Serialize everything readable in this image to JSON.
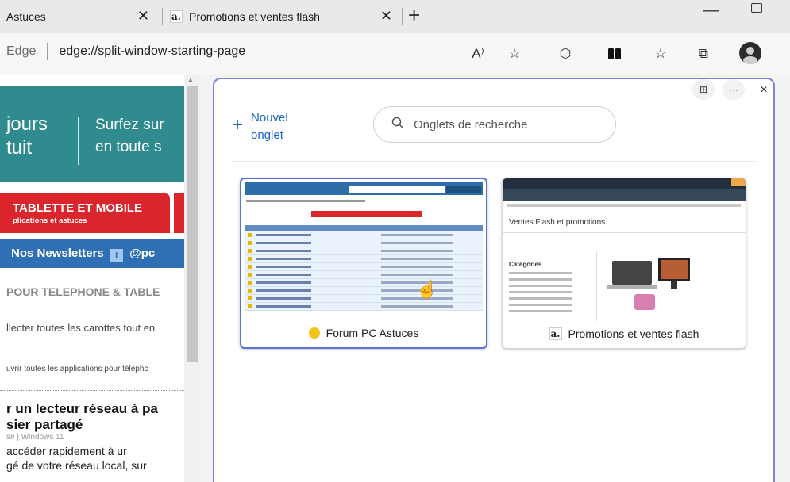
{
  "tabs": [
    {
      "label": "Astuces",
      "close": "✕"
    },
    {
      "label": "Promotions et ventes flash",
      "close": "✕",
      "favicon": "a."
    }
  ],
  "tab_new": "+",
  "window": {
    "minimize": "—"
  },
  "address": {
    "scheme": "Edge",
    "url": "edge://split-window-starting-page"
  },
  "toolbar_icons": [
    "read-aloud-icon",
    "add-favorite-icon",
    "copilot-icon",
    "split-screen-icon",
    "favorites-icon",
    "collections-icon",
    "profile-icon"
  ],
  "toolbar_glyphs": {
    "read_aloud": "A⁾",
    "add_favorite": "☆",
    "copilot": "⬡",
    "favorites": "☆",
    "collections": "⧉"
  },
  "left_page": {
    "banner_left": [
      "jours",
      "tuit"
    ],
    "banner_right": [
      "Surfez sur",
      "en toute s"
    ],
    "category": "TABLETTE ET MOBILE",
    "category_sub": "plications et astuces",
    "newsletters": "Nos Newsletters",
    "twitter_handle": "@pc",
    "section_heading": "POUR TELEPHONE & TABLE",
    "snippet_1": "llecter toutes les carottes tout en",
    "snippet_2": "uvrir toutes les applications pour téléphc",
    "article_title": [
      "r un lecteur réseau à pa",
      "sier partagé"
    ],
    "article_meta": "se | Windows 11",
    "article_body": [
      "accéder rapidement à ur",
      "gé de votre réseau local, sur"
    ]
  },
  "split_pane": {
    "new_tab_label": [
      "Nouvel",
      "onglet"
    ],
    "search_placeholder": "Onglets de recherche",
    "tabs": [
      {
        "title": "Forum PC Astuces",
        "favicon": "bulb"
      },
      {
        "title": "Promotions et ventes flash",
        "favicon": "a."
      }
    ],
    "thumb2_heading": "Ventes Flash et promotions",
    "thumb2_category": "Catégories",
    "pane_buttons": [
      "⊞",
      "···",
      "✕"
    ]
  },
  "colors": {
    "accent": "#7a86d6",
    "link": "#1a63c8",
    "teal": "#2f8b8e",
    "red": "#d9252b",
    "blue_bar": "#2f6fb4"
  }
}
